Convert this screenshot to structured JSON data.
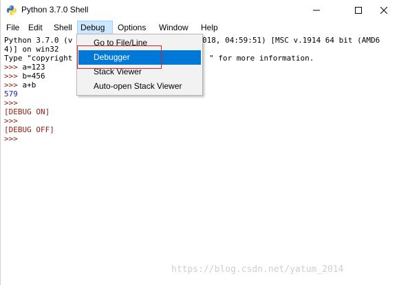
{
  "window": {
    "title": "Python 3.7.0 Shell",
    "icons": {
      "app": "python-icon",
      "minimize": "minimize-icon",
      "maximize": "maximize-icon",
      "close": "close-icon"
    }
  },
  "menubar": {
    "items": [
      {
        "label": "File"
      },
      {
        "label": "Edit"
      },
      {
        "label": "Shell"
      },
      {
        "label": "Debug"
      },
      {
        "label": "Options"
      },
      {
        "label": "Window"
      },
      {
        "label": "Help"
      }
    ],
    "active": "Debug"
  },
  "debug_menu": {
    "items": [
      {
        "label": "Go to File/Line"
      },
      {
        "label": "Debugger"
      },
      {
        "label": "Stack Viewer"
      },
      {
        "label": "Auto-open Stack Viewer"
      }
    ],
    "highlighted": "Debugger"
  },
  "console": {
    "line1_left": "Python 3.7.0 (v",
    "line1_right": "018, 04:59:51) [MSC v.1914 64 bit (AMD6",
    "line2": "4)] on win32",
    "line3_left": "Type \"copyright",
    "line3_right": "\" for more information.",
    "l4_prompt": ">>> ",
    "l4_code": "a=123",
    "l5_prompt": ">>> ",
    "l5_code": "b=456",
    "l6_prompt": ">>> ",
    "l6_code": "a+b",
    "l7_output": "579",
    "l8_prompt": ">>>",
    "l9_debug": "[DEBUG ON]",
    "l10_prompt": ">>>",
    "l11_debug": "[DEBUG OFF]",
    "l12_prompt": ">>>"
  },
  "watermark": "https://blog.csdn.net/yatum_2014",
  "colors": {
    "menu_highlight": "#0078d7",
    "active_menu_bg": "#cce8ff",
    "prompt": "#8b1a10",
    "output": "#2020c0",
    "annotation_box": "#e02020"
  }
}
